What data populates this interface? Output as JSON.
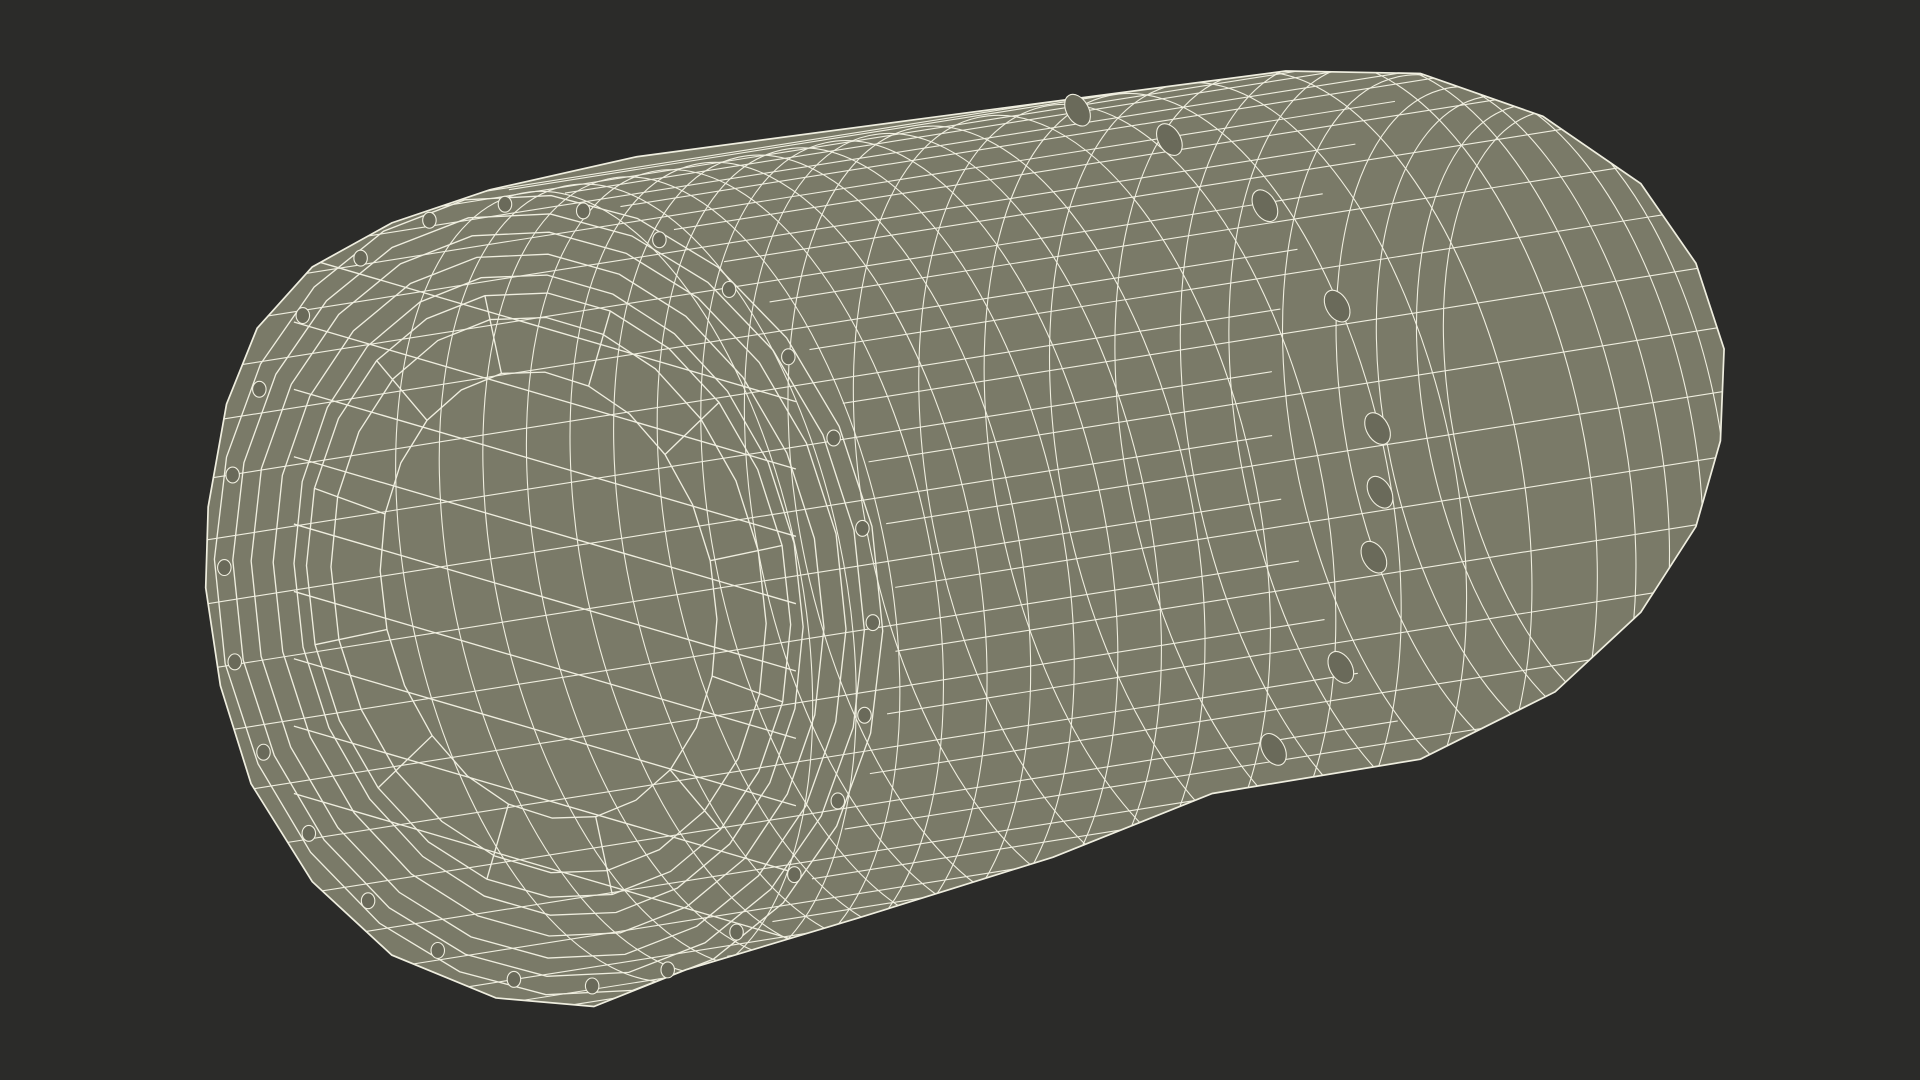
{
  "scene": {
    "background_color": "#2b2b29",
    "mesh_fill_color": "#7a7a68",
    "mesh_shadow_color": "#6a6a5a",
    "wire_color": "#efeedf"
  }
}
